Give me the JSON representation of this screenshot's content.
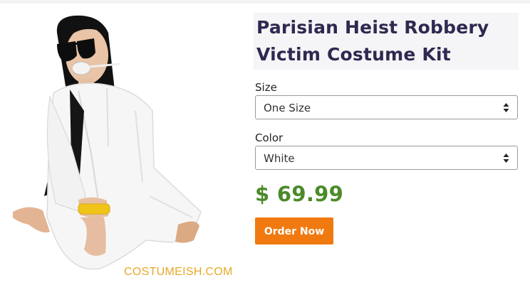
{
  "product": {
    "title_line1": "Parisian Heist Robbery",
    "title_line2": "Victim Costume Kit",
    "price": "$ 69.99",
    "image_watermark": "COSTUMEISH.COM"
  },
  "options": {
    "size": {
      "label": "Size",
      "selected": "One Size"
    },
    "color": {
      "label": "Color",
      "selected": "White"
    }
  },
  "actions": {
    "order_label": "Order Now"
  },
  "colors": {
    "title": "#2e2950",
    "price": "#4c8a2a",
    "button": "#f07a10",
    "watermark": "#e8a928"
  }
}
